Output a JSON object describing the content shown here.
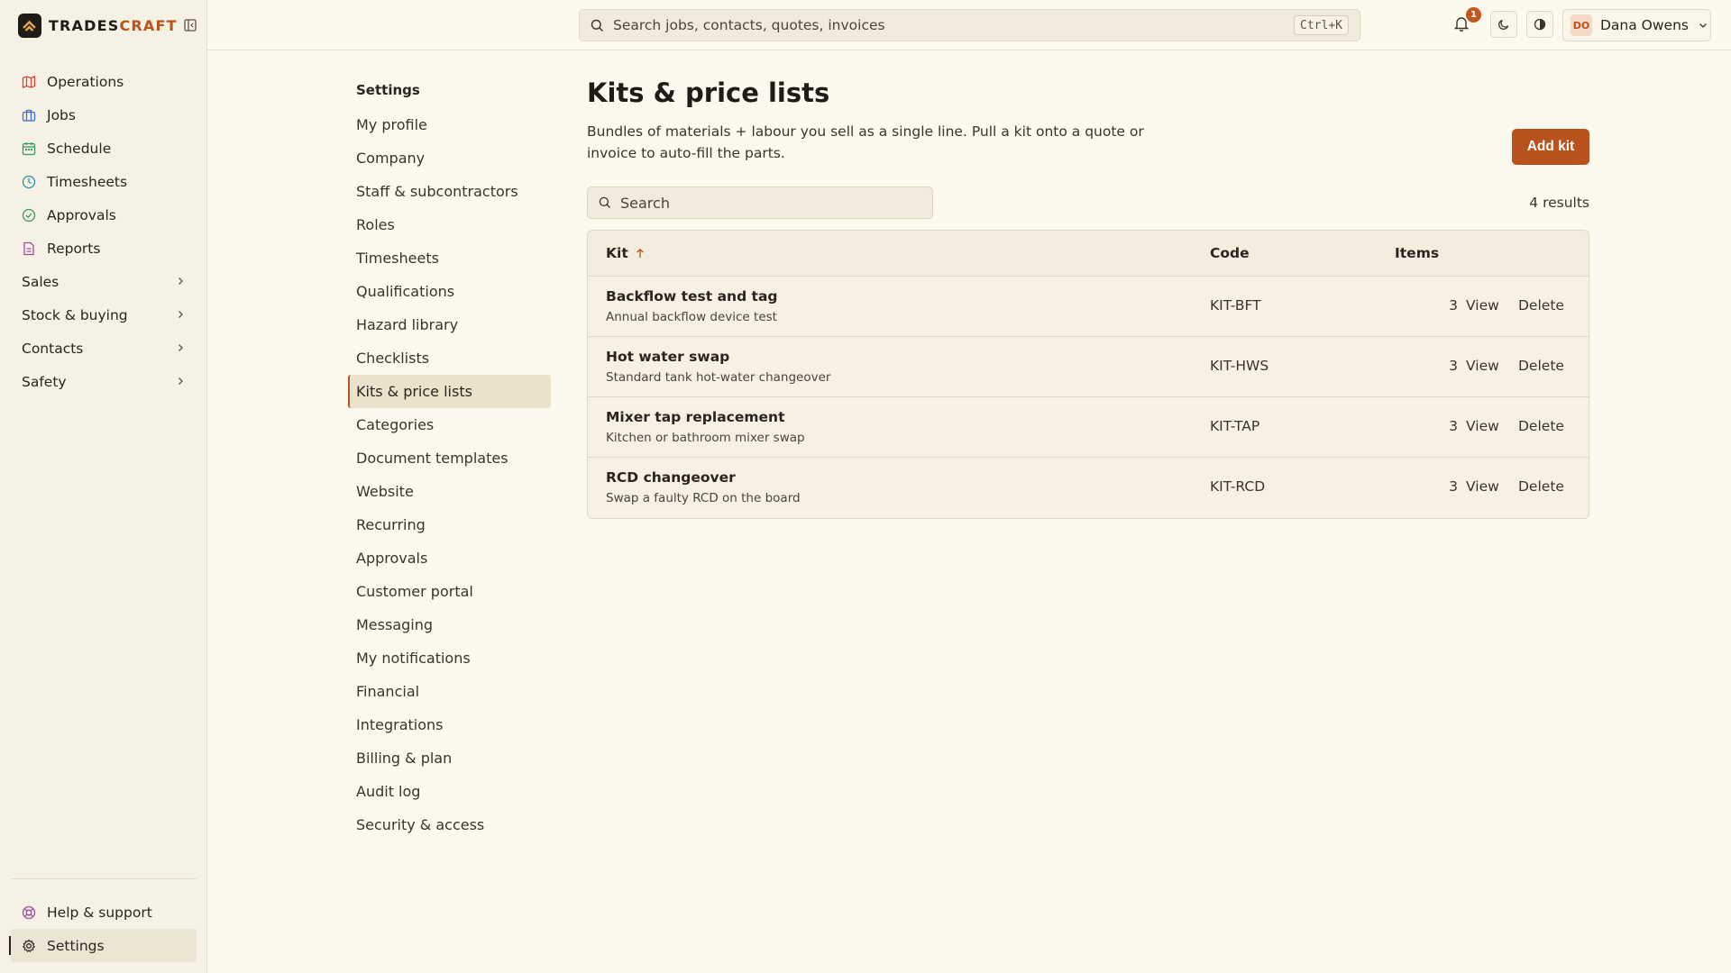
{
  "brand": {
    "name_main": "TRADES",
    "name_accent": "CRAFT"
  },
  "sidebar": {
    "items": [
      {
        "label": "Operations",
        "icon": "map-icon",
        "color": "#d0463b"
      },
      {
        "label": "Jobs",
        "icon": "briefcase-icon",
        "color": "#3d6fc4"
      },
      {
        "label": "Schedule",
        "icon": "calendar-icon",
        "color": "#3a9a5b"
      },
      {
        "label": "Timesheets",
        "icon": "clock-icon",
        "color": "#2f8fb0"
      },
      {
        "label": "Approvals",
        "icon": "check-circle-icon",
        "color": "#3a9a5b"
      },
      {
        "label": "Reports",
        "icon": "report-icon",
        "color": "#a04ba0"
      }
    ],
    "groups": [
      {
        "label": "Sales"
      },
      {
        "label": "Stock & buying"
      },
      {
        "label": "Contacts"
      },
      {
        "label": "Safety"
      }
    ],
    "bottom": [
      {
        "label": "Help & support",
        "icon": "help-icon",
        "color": "#a04ba0"
      },
      {
        "label": "Settings",
        "icon": "gear-icon",
        "color": "#2a2520"
      }
    ]
  },
  "topbar": {
    "search_placeholder": "Search jobs, contacts, quotes, invoices",
    "shortcut": "Ctrl+K",
    "notification_count": "1",
    "user_initials": "DO",
    "user_name": "Dana Owens"
  },
  "settings_nav": {
    "title": "Settings",
    "items": [
      "My profile",
      "Company",
      "Staff & subcontractors",
      "Roles",
      "Timesheets",
      "Qualifications",
      "Hazard library",
      "Checklists",
      "Kits & price lists",
      "Categories",
      "Document templates",
      "Website",
      "Recurring",
      "Approvals",
      "Customer portal",
      "Messaging",
      "My notifications",
      "Financial",
      "Integrations",
      "Billing & plan",
      "Audit log",
      "Security & access"
    ],
    "active": "Kits & price lists"
  },
  "main": {
    "title": "Kits & price lists",
    "description": "Bundles of materials + labour you sell as a single line. Pull a kit onto a quote or invoice to auto-fill the parts.",
    "add_label": "Add kit",
    "search_placeholder": "Search",
    "result_count": "4 results",
    "columns": {
      "kit": "Kit",
      "code": "Code",
      "items": "Items"
    },
    "rows": [
      {
        "name": "Backflow test and tag",
        "desc": "Annual backflow device test",
        "code": "KIT-BFT",
        "items": "3",
        "view": "View",
        "delete": "Delete"
      },
      {
        "name": "Hot water swap",
        "desc": "Standard tank hot-water changeover",
        "code": "KIT-HWS",
        "items": "3",
        "view": "View",
        "delete": "Delete"
      },
      {
        "name": "Mixer tap replacement",
        "desc": "Kitchen or bathroom mixer swap",
        "code": "KIT-TAP",
        "items": "3",
        "view": "View",
        "delete": "Delete"
      },
      {
        "name": "RCD changeover",
        "desc": "Swap a faulty RCD on the board",
        "code": "KIT-RCD",
        "items": "3",
        "view": "View",
        "delete": "Delete"
      }
    ]
  },
  "colors": {
    "accent": "#b9531d",
    "background": "#fbf8ee",
    "sidebar": "#f5f1e4"
  }
}
